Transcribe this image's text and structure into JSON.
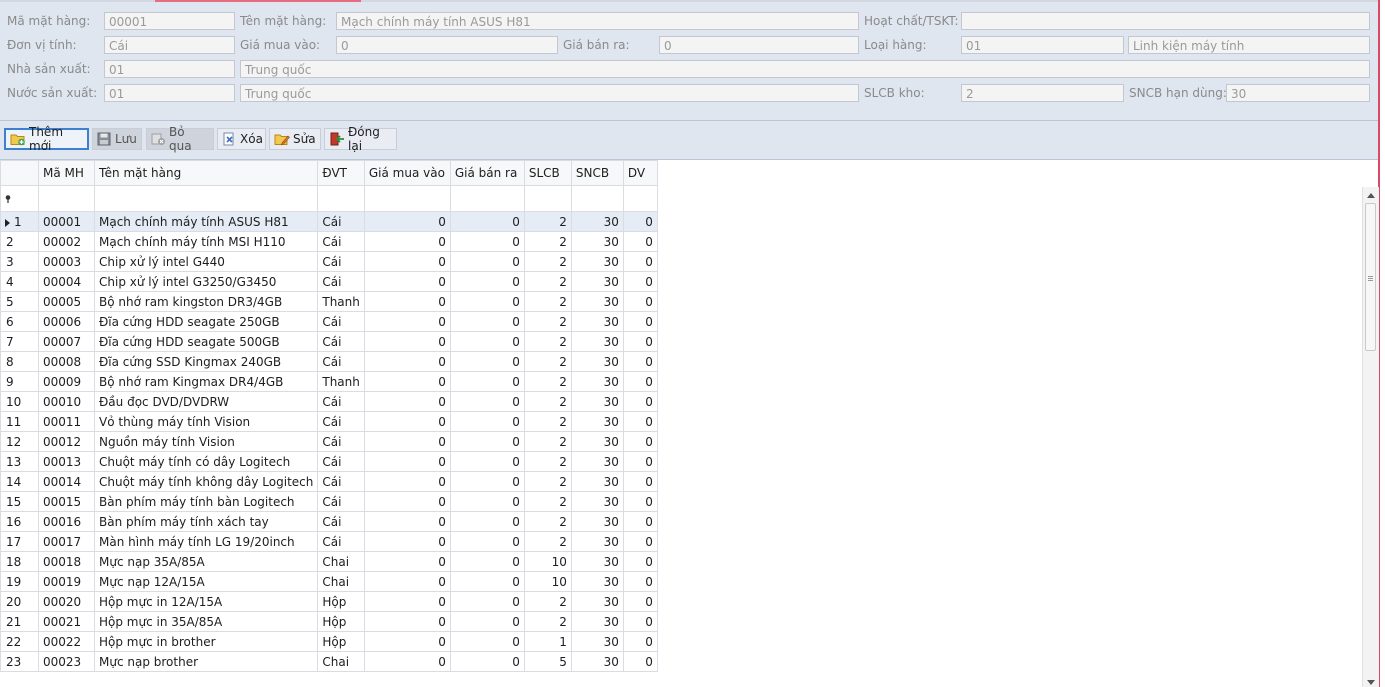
{
  "form": {
    "ma_mat_hang": {
      "label": "Mã mặt hàng:",
      "value": "00001"
    },
    "ten_mat_hang": {
      "label": "Tên mặt hàng:",
      "value": "Mạch chính máy tính ASUS H81"
    },
    "hoat_chat": {
      "label": "Hoạt chất/TSKT:",
      "value": ""
    },
    "don_vi_tinh": {
      "label": "Đơn vị tính:",
      "value": "Cái"
    },
    "gia_mua_vao": {
      "label": "Giá mua vào:",
      "value": "0"
    },
    "gia_ban_ra": {
      "label": "Giá bán ra:",
      "value": "0"
    },
    "loai_hang": {
      "label": "Loại hàng:",
      "code": "01",
      "name": "Linh kiện máy tính"
    },
    "nha_san_xuat": {
      "label": "Nhà sản xuất:",
      "code": "01",
      "name": "Trung quốc"
    },
    "nuoc_san_xuat": {
      "label": "Nước sản xuất:",
      "code": "01",
      "name": "Trung quốc"
    },
    "slcb_kho": {
      "label": "SLCB kho:",
      "value": "2"
    },
    "sncb_han_dung": {
      "label": "SNCB hạn dùng:",
      "value": "30"
    }
  },
  "toolbar": {
    "them_moi": "Thêm mới",
    "luu": "Lưu",
    "bo_qua": "Bỏ qua",
    "xoa": "Xóa",
    "sua": "Sửa",
    "dong_lai": "Đóng lại"
  },
  "grid": {
    "columns": [
      "Mã MH",
      "Tên mặt hàng",
      "ĐVT",
      "Giá mua vào",
      "Giá bán ra",
      "SLCB",
      "SNCB",
      "DV"
    ],
    "selected_row": 0,
    "rows": [
      [
        "1",
        "00001",
        "Mạch chính máy tính ASUS H81",
        "Cái",
        "0",
        "0",
        "2",
        "30",
        "0"
      ],
      [
        "2",
        "00002",
        "Mạch chính máy tính MSI H110",
        "Cái",
        "0",
        "0",
        "2",
        "30",
        "0"
      ],
      [
        "3",
        "00003",
        "Chip xử lý intel G440",
        "Cái",
        "0",
        "0",
        "2",
        "30",
        "0"
      ],
      [
        "4",
        "00004",
        "Chip xử lý intel G3250/G3450",
        "Cái",
        "0",
        "0",
        "2",
        "30",
        "0"
      ],
      [
        "5",
        "00005",
        "Bộ nhớ ram kingston DR3/4GB",
        "Thanh",
        "0",
        "0",
        "2",
        "30",
        "0"
      ],
      [
        "6",
        "00006",
        "Đĩa cứng HDD seagate 250GB",
        "Cái",
        "0",
        "0",
        "2",
        "30",
        "0"
      ],
      [
        "7",
        "00007",
        "Đĩa cứng HDD seagate 500GB",
        "Cái",
        "0",
        "0",
        "2",
        "30",
        "0"
      ],
      [
        "8",
        "00008",
        "Đĩa cứng SSD Kingmax 240GB",
        "Cái",
        "0",
        "0",
        "2",
        "30",
        "0"
      ],
      [
        "9",
        "00009",
        "Bộ nhớ ram Kingmax DR4/4GB",
        "Thanh",
        "0",
        "0",
        "2",
        "30",
        "0"
      ],
      [
        "10",
        "00010",
        "Đầu đọc DVD/DVDRW",
        "Cái",
        "0",
        "0",
        "2",
        "30",
        "0"
      ],
      [
        "11",
        "00011",
        "Vỏ thùng máy tính Vision",
        "Cái",
        "0",
        "0",
        "2",
        "30",
        "0"
      ],
      [
        "12",
        "00012",
        "Nguồn máy tính Vision",
        "Cái",
        "0",
        "0",
        "2",
        "30",
        "0"
      ],
      [
        "13",
        "00013",
        "Chuột máy tính có dây Logitech",
        "Cái",
        "0",
        "0",
        "2",
        "30",
        "0"
      ],
      [
        "14",
        "00014",
        "Chuột máy tính không dây Logitech",
        "Cái",
        "0",
        "0",
        "2",
        "30",
        "0"
      ],
      [
        "15",
        "00015",
        "Bàn phím máy tính bàn Logitech",
        "Cái",
        "0",
        "0",
        "2",
        "30",
        "0"
      ],
      [
        "16",
        "00016",
        "Bàn phím máy tính xách tay",
        "Cái",
        "0",
        "0",
        "2",
        "30",
        "0"
      ],
      [
        "17",
        "00017",
        "Màn hình máy tính LG 19/20inch",
        "Cái",
        "0",
        "0",
        "2",
        "30",
        "0"
      ],
      [
        "18",
        "00018",
        "Mực nạp 35A/85A",
        "Chai",
        "0",
        "0",
        "10",
        "30",
        "0"
      ],
      [
        "19",
        "00019",
        "Mực nạp 12A/15A",
        "Chai",
        "0",
        "0",
        "10",
        "30",
        "0"
      ],
      [
        "20",
        "00020",
        "Hộp mực in 12A/15A",
        "Hộp",
        "0",
        "0",
        "2",
        "30",
        "0"
      ],
      [
        "21",
        "00021",
        "Hộp mực in 35A/85A",
        "Hộp",
        "0",
        "0",
        "2",
        "30",
        "0"
      ],
      [
        "22",
        "00022",
        "Hộp mực in brother",
        "Hộp",
        "0",
        "0",
        "1",
        "30",
        "0"
      ],
      [
        "23",
        "00023",
        "Mực nạp brother",
        "Chai",
        "0",
        "0",
        "5",
        "30",
        "0"
      ]
    ]
  }
}
